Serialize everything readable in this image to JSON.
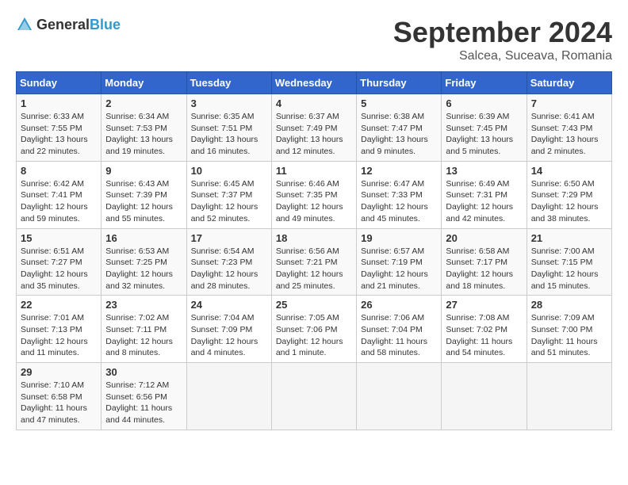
{
  "logo": {
    "text_general": "General",
    "text_blue": "Blue"
  },
  "header": {
    "month_year": "September 2024",
    "location": "Salcea, Suceava, Romania"
  },
  "weekdays": [
    "Sunday",
    "Monday",
    "Tuesday",
    "Wednesday",
    "Thursday",
    "Friday",
    "Saturday"
  ],
  "weeks": [
    [
      {
        "day": "1",
        "sunrise": "Sunrise: 6:33 AM",
        "sunset": "Sunset: 7:55 PM",
        "daylight": "Daylight: 13 hours and 22 minutes."
      },
      {
        "day": "2",
        "sunrise": "Sunrise: 6:34 AM",
        "sunset": "Sunset: 7:53 PM",
        "daylight": "Daylight: 13 hours and 19 minutes."
      },
      {
        "day": "3",
        "sunrise": "Sunrise: 6:35 AM",
        "sunset": "Sunset: 7:51 PM",
        "daylight": "Daylight: 13 hours and 16 minutes."
      },
      {
        "day": "4",
        "sunrise": "Sunrise: 6:37 AM",
        "sunset": "Sunset: 7:49 PM",
        "daylight": "Daylight: 13 hours and 12 minutes."
      },
      {
        "day": "5",
        "sunrise": "Sunrise: 6:38 AM",
        "sunset": "Sunset: 7:47 PM",
        "daylight": "Daylight: 13 hours and 9 minutes."
      },
      {
        "day": "6",
        "sunrise": "Sunrise: 6:39 AM",
        "sunset": "Sunset: 7:45 PM",
        "daylight": "Daylight: 13 hours and 5 minutes."
      },
      {
        "day": "7",
        "sunrise": "Sunrise: 6:41 AM",
        "sunset": "Sunset: 7:43 PM",
        "daylight": "Daylight: 13 hours and 2 minutes."
      }
    ],
    [
      {
        "day": "8",
        "sunrise": "Sunrise: 6:42 AM",
        "sunset": "Sunset: 7:41 PM",
        "daylight": "Daylight: 12 hours and 59 minutes."
      },
      {
        "day": "9",
        "sunrise": "Sunrise: 6:43 AM",
        "sunset": "Sunset: 7:39 PM",
        "daylight": "Daylight: 12 hours and 55 minutes."
      },
      {
        "day": "10",
        "sunrise": "Sunrise: 6:45 AM",
        "sunset": "Sunset: 7:37 PM",
        "daylight": "Daylight: 12 hours and 52 minutes."
      },
      {
        "day": "11",
        "sunrise": "Sunrise: 6:46 AM",
        "sunset": "Sunset: 7:35 PM",
        "daylight": "Daylight: 12 hours and 49 minutes."
      },
      {
        "day": "12",
        "sunrise": "Sunrise: 6:47 AM",
        "sunset": "Sunset: 7:33 PM",
        "daylight": "Daylight: 12 hours and 45 minutes."
      },
      {
        "day": "13",
        "sunrise": "Sunrise: 6:49 AM",
        "sunset": "Sunset: 7:31 PM",
        "daylight": "Daylight: 12 hours and 42 minutes."
      },
      {
        "day": "14",
        "sunrise": "Sunrise: 6:50 AM",
        "sunset": "Sunset: 7:29 PM",
        "daylight": "Daylight: 12 hours and 38 minutes."
      }
    ],
    [
      {
        "day": "15",
        "sunrise": "Sunrise: 6:51 AM",
        "sunset": "Sunset: 7:27 PM",
        "daylight": "Daylight: 12 hours and 35 minutes."
      },
      {
        "day": "16",
        "sunrise": "Sunrise: 6:53 AM",
        "sunset": "Sunset: 7:25 PM",
        "daylight": "Daylight: 12 hours and 32 minutes."
      },
      {
        "day": "17",
        "sunrise": "Sunrise: 6:54 AM",
        "sunset": "Sunset: 7:23 PM",
        "daylight": "Daylight: 12 hours and 28 minutes."
      },
      {
        "day": "18",
        "sunrise": "Sunrise: 6:56 AM",
        "sunset": "Sunset: 7:21 PM",
        "daylight": "Daylight: 12 hours and 25 minutes."
      },
      {
        "day": "19",
        "sunrise": "Sunrise: 6:57 AM",
        "sunset": "Sunset: 7:19 PM",
        "daylight": "Daylight: 12 hours and 21 minutes."
      },
      {
        "day": "20",
        "sunrise": "Sunrise: 6:58 AM",
        "sunset": "Sunset: 7:17 PM",
        "daylight": "Daylight: 12 hours and 18 minutes."
      },
      {
        "day": "21",
        "sunrise": "Sunrise: 7:00 AM",
        "sunset": "Sunset: 7:15 PM",
        "daylight": "Daylight: 12 hours and 15 minutes."
      }
    ],
    [
      {
        "day": "22",
        "sunrise": "Sunrise: 7:01 AM",
        "sunset": "Sunset: 7:13 PM",
        "daylight": "Daylight: 12 hours and 11 minutes."
      },
      {
        "day": "23",
        "sunrise": "Sunrise: 7:02 AM",
        "sunset": "Sunset: 7:11 PM",
        "daylight": "Daylight: 12 hours and 8 minutes."
      },
      {
        "day": "24",
        "sunrise": "Sunrise: 7:04 AM",
        "sunset": "Sunset: 7:09 PM",
        "daylight": "Daylight: 12 hours and 4 minutes."
      },
      {
        "day": "25",
        "sunrise": "Sunrise: 7:05 AM",
        "sunset": "Sunset: 7:06 PM",
        "daylight": "Daylight: 12 hours and 1 minute."
      },
      {
        "day": "26",
        "sunrise": "Sunrise: 7:06 AM",
        "sunset": "Sunset: 7:04 PM",
        "daylight": "Daylight: 11 hours and 58 minutes."
      },
      {
        "day": "27",
        "sunrise": "Sunrise: 7:08 AM",
        "sunset": "Sunset: 7:02 PM",
        "daylight": "Daylight: 11 hours and 54 minutes."
      },
      {
        "day": "28",
        "sunrise": "Sunrise: 7:09 AM",
        "sunset": "Sunset: 7:00 PM",
        "daylight": "Daylight: 11 hours and 51 minutes."
      }
    ],
    [
      {
        "day": "29",
        "sunrise": "Sunrise: 7:10 AM",
        "sunset": "Sunset: 6:58 PM",
        "daylight": "Daylight: 11 hours and 47 minutes."
      },
      {
        "day": "30",
        "sunrise": "Sunrise: 7:12 AM",
        "sunset": "Sunset: 6:56 PM",
        "daylight": "Daylight: 11 hours and 44 minutes."
      },
      {
        "day": "",
        "sunrise": "",
        "sunset": "",
        "daylight": ""
      },
      {
        "day": "",
        "sunrise": "",
        "sunset": "",
        "daylight": ""
      },
      {
        "day": "",
        "sunrise": "",
        "sunset": "",
        "daylight": ""
      },
      {
        "day": "",
        "sunrise": "",
        "sunset": "",
        "daylight": ""
      },
      {
        "day": "",
        "sunrise": "",
        "sunset": "",
        "daylight": ""
      }
    ]
  ]
}
